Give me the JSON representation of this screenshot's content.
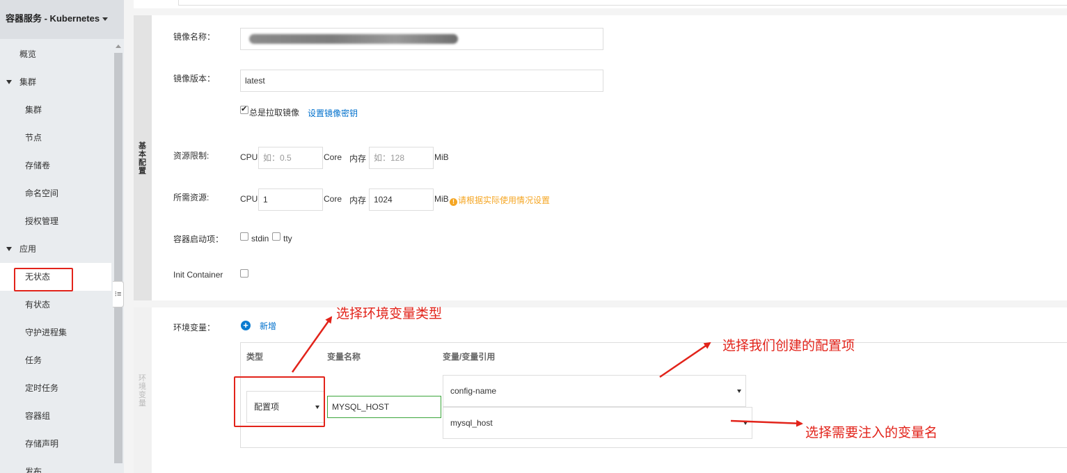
{
  "sidebar": {
    "title": "容器服务 - Kubernetes",
    "items": [
      {
        "label": "概览"
      },
      {
        "label": "集群"
      },
      {
        "label": "集群"
      },
      {
        "label": "节点"
      },
      {
        "label": "存储卷"
      },
      {
        "label": "命名空间"
      },
      {
        "label": "授权管理"
      },
      {
        "label": "应用"
      },
      {
        "label": "无状态"
      },
      {
        "label": "有状态"
      },
      {
        "label": "守护进程集"
      },
      {
        "label": "任务"
      },
      {
        "label": "定时任务"
      },
      {
        "label": "容器组"
      },
      {
        "label": "存储声明"
      },
      {
        "label": "发布"
      }
    ]
  },
  "basic": {
    "tab_label": "基本配置",
    "image_name_label": "镜像名称：",
    "image_version_label": "镜像版本：",
    "image_version_value": "latest",
    "always_pull_label": "总是拉取镜像",
    "always_pull_checked": true,
    "set_secret_link": "设置镜像密钥",
    "limit_label": "资源限制:",
    "request_label": "所需资源:",
    "cpu_label": "CPU",
    "core_label": "Core",
    "mem_label": "内存",
    "mib_label": "MiB",
    "limit_cpu_placeholder": "如：0.5",
    "limit_mem_placeholder": "如：128",
    "request_cpu_value": "1",
    "request_mem_value": "1024",
    "request_hint": "请根据实际使用情况设置",
    "startup_label": "容器启动项：",
    "stdin_label": "stdin",
    "tty_label": "tty",
    "init_container_label": "Init Container"
  },
  "env": {
    "tab_label": "环境变量",
    "label": "环境变量：",
    "add_label": "新增",
    "col_type": "类型",
    "col_name": "变量名称",
    "col_ref": "变量/变量引用",
    "type_value": "配置项",
    "name_value": "MYSQL_HOST",
    "config_value": "config-name",
    "key_value": "mysql_host"
  },
  "annotations": {
    "select_type": "选择环境变量类型",
    "select_config": "选择我们创建的配置项",
    "select_key": "选择需要注入的变量名"
  },
  "colors": {
    "annotation_red": "#e2231a",
    "link_blue": "#0070cc",
    "warning_orange": "#f5a623",
    "valid_green": "#3aa53a"
  }
}
